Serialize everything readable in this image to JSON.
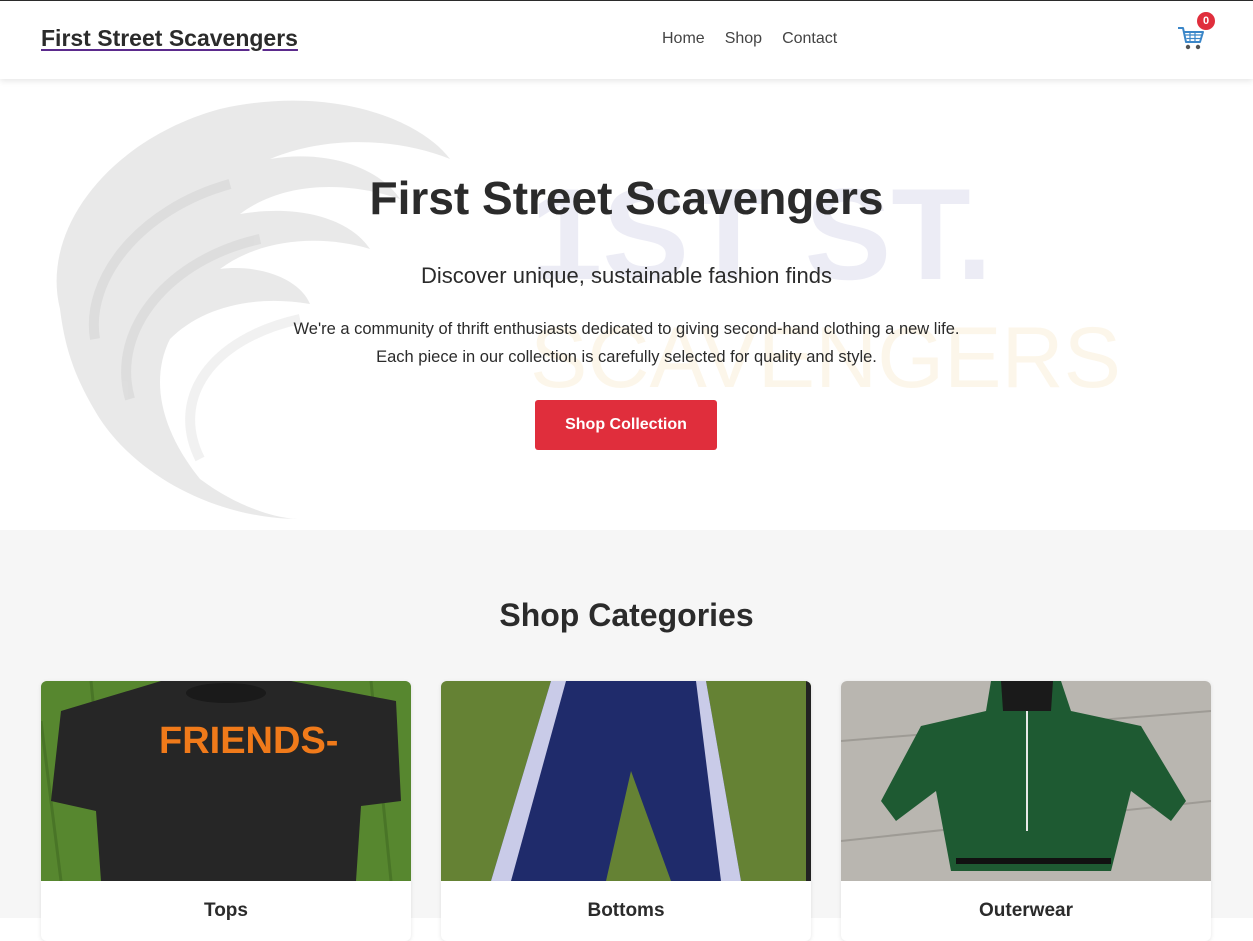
{
  "header": {
    "logo": "First Street Scavengers",
    "nav": [
      "Home",
      "Shop",
      "Contact"
    ],
    "cart_count": "0",
    "cart_icon": "cart-icon"
  },
  "hero": {
    "title": "First Street Scavengers",
    "subtitle": "Discover unique, sustainable fashion finds",
    "description": "We're a community of thrift enthusiasts dedicated to giving second-hand clothing a new life. Each piece in our collection is carefully selected for quality and style.",
    "button": "Shop Collection",
    "watermark_top": "1ST ST.",
    "watermark_bottom": "SCAVENGERS",
    "watermark_icon": "eagle-logo-watermark"
  },
  "categories": {
    "title": "Shop Categories",
    "items": [
      {
        "label": "Tops",
        "image_text": "FRIENDS-"
      },
      {
        "label": "Bottoms"
      },
      {
        "label": "Outerwear"
      }
    ]
  },
  "colors": {
    "accent": "#e02e3c",
    "text": "#2b2b2b",
    "section_bg": "#f6f6f6"
  }
}
